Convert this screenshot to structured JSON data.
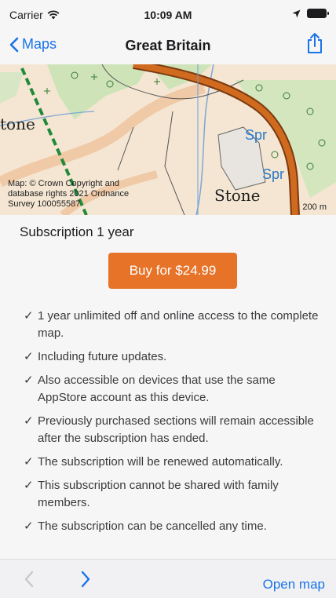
{
  "status": {
    "carrier": "Carrier",
    "time": "10:09 AM"
  },
  "nav": {
    "back_label": "Maps",
    "title": "Great Britain"
  },
  "map": {
    "attribution": "Map: © Crown Copyright and database rights 2021 Ordnance Survey 100055587",
    "label_stone_left": "tone",
    "label_stone": "Stone",
    "label_spr1": "Spr",
    "label_spr2": "Spr",
    "scale": "200 m"
  },
  "subscription": {
    "title": "Subscription 1 year",
    "buy_label": "Buy for $24.99",
    "features": [
      "1 year unlimited off and online access to the complete map.",
      "Including future updates.",
      "Also accessible on devices that use the same AppStore account as this device.",
      "Previously purchased sections will remain accessible after the subscription has ended.",
      "The subscription will be renewed automatically.",
      "This subscription cannot be shared with family members.",
      "The subscription can be cancelled any time."
    ],
    "check_glyph": "✓"
  },
  "toolbar": {
    "open_label": "Open map"
  },
  "colors": {
    "accent": "#1a73e8",
    "buy": "#e67328",
    "road": "#d06a1e"
  }
}
